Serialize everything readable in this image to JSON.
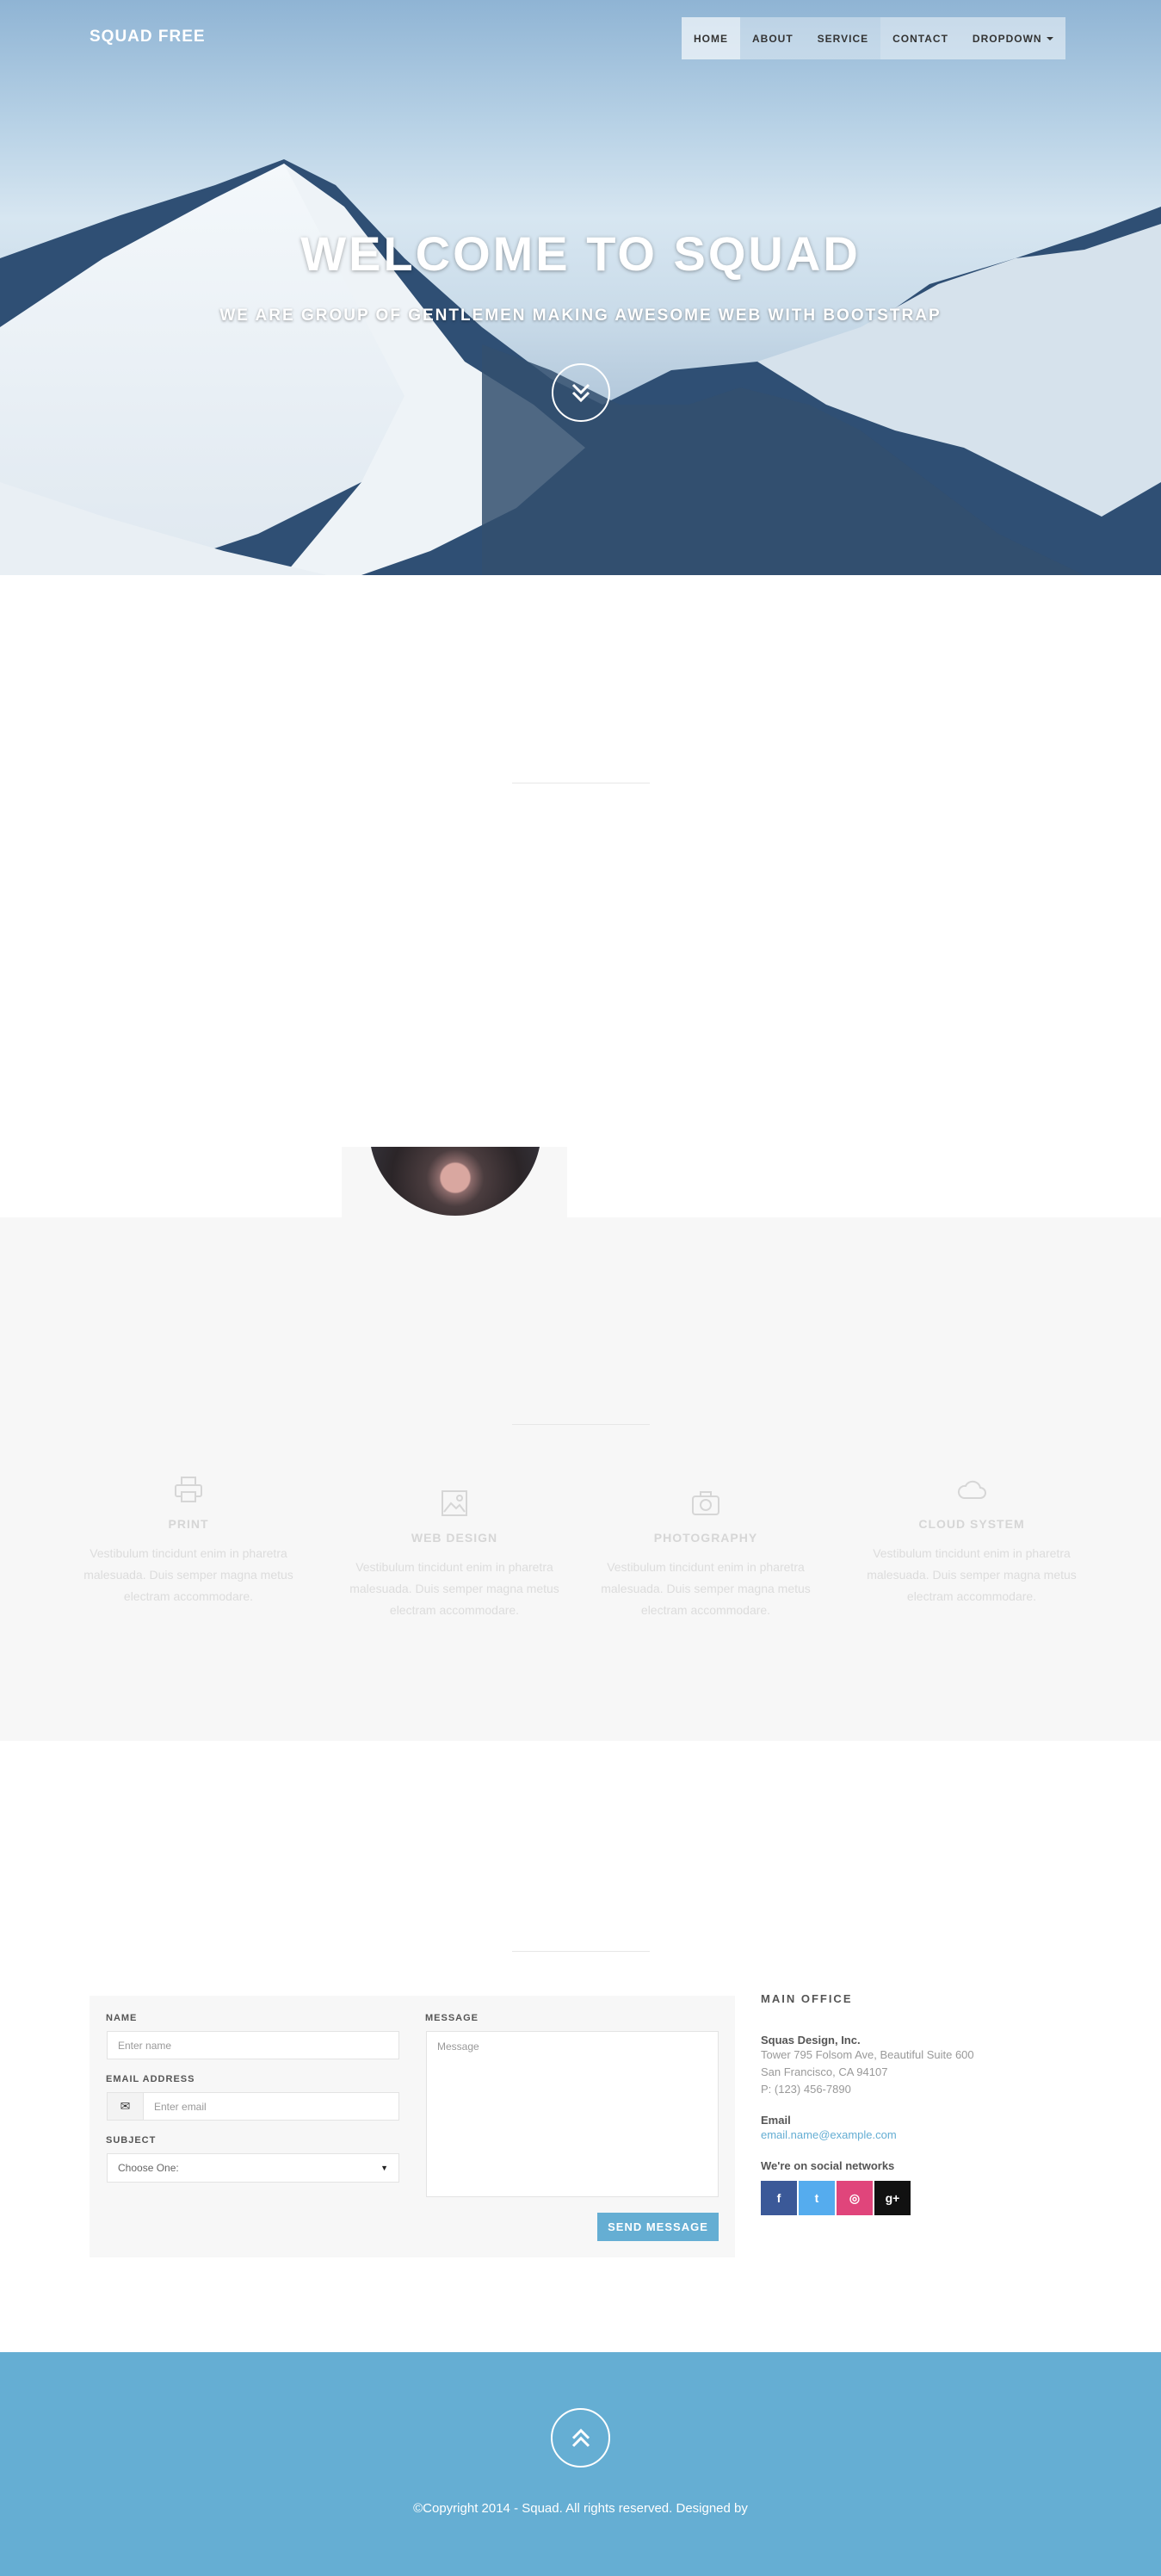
{
  "brand": "SQUAD FREE",
  "nav": [
    "HOME",
    "ABOUT",
    "SERVICE",
    "CONTACT",
    "DROPDOWN"
  ],
  "hero": {
    "title": "WELCOME TO SQUAD",
    "subtitle": "WE ARE GROUP OF GENTLEMEN MAKING AWESOME WEB WITH BOOTSTRAP"
  },
  "services": [
    {
      "icon": "printer-icon",
      "title": "PRINT",
      "text": "Vestibulum tincidunt enim in pharetra malesuada. Duis semper magna metus electram accommodare."
    },
    {
      "icon": "image-icon",
      "title": "WEB DESIGN",
      "text": "Vestibulum tincidunt enim in pharetra malesuada. Duis semper magna metus electram accommodare."
    },
    {
      "icon": "camera-icon",
      "title": "PHOTOGRAPHY",
      "text": "Vestibulum tincidunt enim in pharetra malesuada. Duis semper magna metus electram accommodare."
    },
    {
      "icon": "cloud-icon",
      "title": "CLOUD SYSTEM",
      "text": "Vestibulum tincidunt enim in pharetra malesuada. Duis semper magna metus electram accommodare."
    }
  ],
  "form": {
    "name_label": "NAME",
    "name_placeholder": "Enter name",
    "email_label": "EMAIL ADDRESS",
    "email_placeholder": "Enter email",
    "subject_label": "SUBJECT",
    "subject_value": "Choose One:",
    "message_label": "MESSAGE",
    "message_placeholder": "Message",
    "send": "SEND MESSAGE"
  },
  "office": {
    "heading": "MAIN OFFICE",
    "company": "Squas Design, Inc.",
    "address1": "Tower 795 Folsom Ave, Beautiful Suite 600",
    "address2": "San Francisco, CA 94107",
    "phone": "P: (123) 456-7890",
    "email_heading": "Email",
    "email": "email.name@example.com",
    "social_heading": "We're on social networks",
    "social": [
      {
        "icon": "facebook-icon",
        "glyph": "f",
        "color": "#3b5998"
      },
      {
        "icon": "twitter-icon",
        "glyph": "t",
        "color": "#55acee"
      },
      {
        "icon": "dribbble-icon",
        "glyph": "◎",
        "color": "#e0457b"
      },
      {
        "icon": "google-plus-icon",
        "glyph": "g+",
        "color": "#111111"
      }
    ]
  },
  "footer": {
    "copyright": "©Copyright 2014 - Squad. All rights reserved. Designed by"
  }
}
